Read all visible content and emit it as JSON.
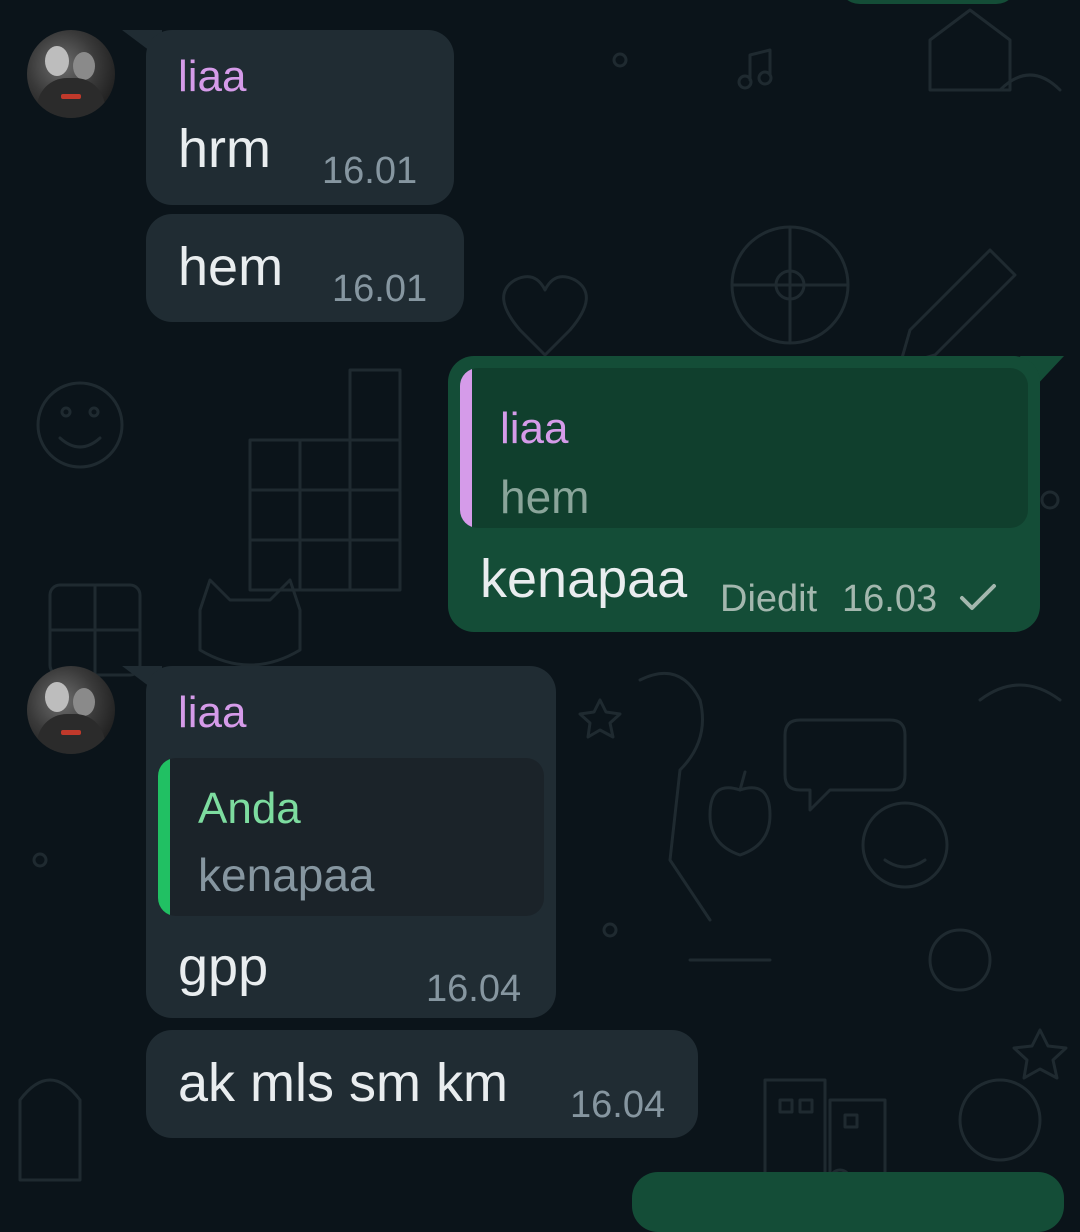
{
  "colors": {
    "background": "#0b141a",
    "incoming_bubble": "#202c33",
    "outgoing_bubble": "#144d37",
    "sender_name": "#d59be9",
    "self_quote_name": "#7ddc9f",
    "self_quote_bar": "#21c063",
    "timestamp": "#8696a0"
  },
  "messages": [
    {
      "sender": "liaa",
      "text": "hrm",
      "time": "16.01"
    },
    {
      "text": "hem",
      "time": "16.01"
    },
    {
      "quote": {
        "author": "liaa",
        "text": "hem"
      },
      "text": "kenapaa",
      "edited_label": "Diedit",
      "time": "16.03",
      "status_icon": "check-icon"
    },
    {
      "sender": "liaa",
      "quote": {
        "author": "Anda",
        "text": "kenapaa"
      },
      "text": "gpp",
      "time": "16.04"
    },
    {
      "text": "ak mls sm km",
      "time": "16.04"
    }
  ]
}
